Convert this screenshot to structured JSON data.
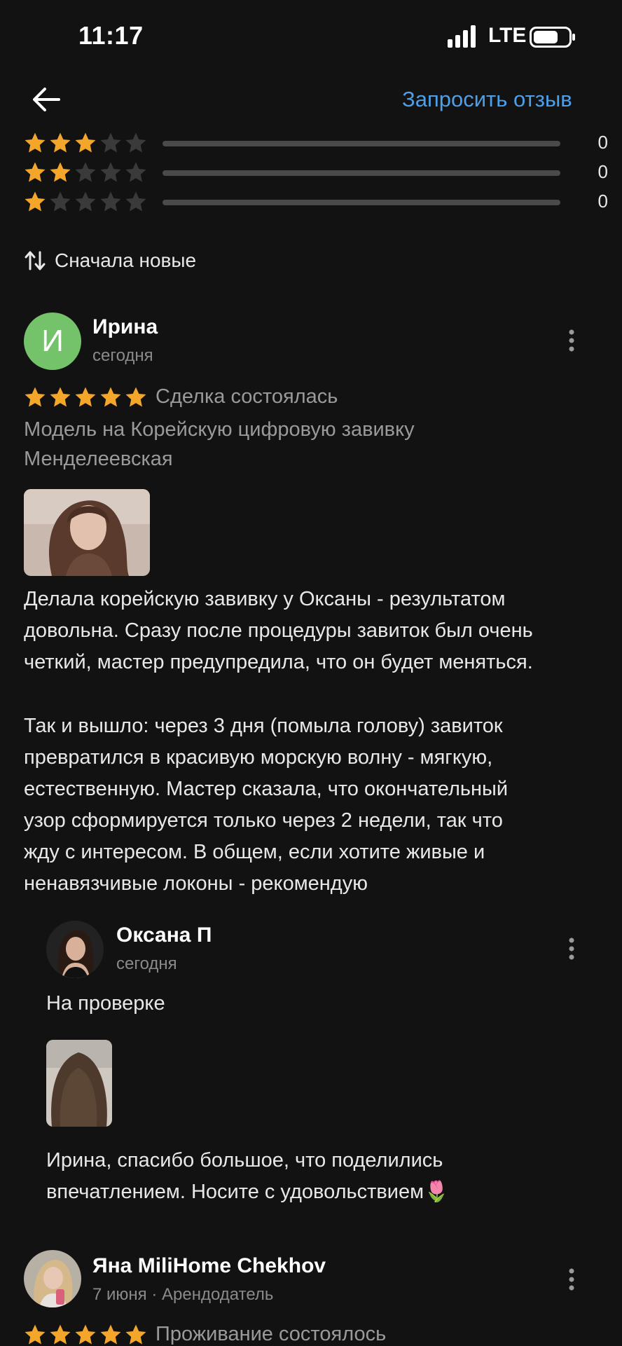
{
  "status_bar": {
    "time": "11:17",
    "network": "LTE"
  },
  "header": {
    "request_review": "Запросить отзыв"
  },
  "ratings": [
    {
      "stars": 3,
      "count": "0"
    },
    {
      "stars": 2,
      "count": "0"
    },
    {
      "stars": 1,
      "count": "0"
    }
  ],
  "sort": {
    "label": "Сначала новые"
  },
  "review1": {
    "avatar_letter": "И",
    "author": "Ирина",
    "date": "сегодня",
    "stars": 5,
    "status": "Сделка состоялась",
    "listing_line1": "Модель на Корейскую цифровую завивку",
    "listing_line2": "Менделеевская",
    "text_p1": "Делала корейскую завивку у Оксаны - результатом\nдовольна. Сразу после процедуры завиток был очень\nчеткий, мастер предупредила, что он будет меняться.",
    "text_p2": "Так и вышло: через 3 дня (помыла голову) завиток\nпревратился в красивую морскую волну - мягкую,\nестественную. Мастер сказала, что окончательный\nузор сформируется только через 2 недели, так что\nжду с интересом. В общем, если хотите живые и\nненавязчивые локоны - рекомендую"
  },
  "reply1": {
    "author": "Оксана П",
    "date": "сегодня",
    "status": "На проверке",
    "text": "Ирина, спасибо большое, что поделились\nвпечатлением. Носите с удовольствием🌷"
  },
  "review2": {
    "author": "Яна MiliHome Chekhov",
    "date": "7 июня · Арендодатель",
    "stars": 5,
    "status": "Проживание состоялось"
  },
  "colors": {
    "star": "#f4a62a",
    "star_empty": "#3a3a3a",
    "accent": "#4d9fe8",
    "avatar": "#74c26a"
  }
}
